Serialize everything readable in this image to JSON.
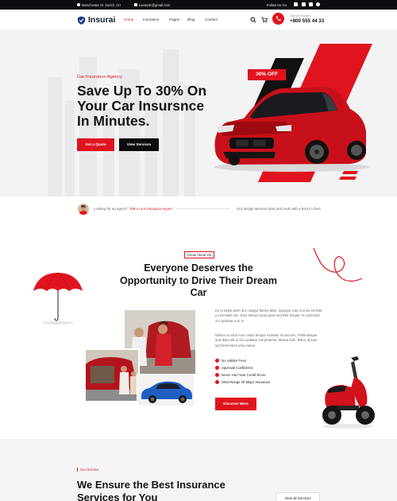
{
  "topbar": {
    "address": "Manchester St. Zurich, CH",
    "email": "example@gmail.com",
    "follow_label": "Follow Us On"
  },
  "header": {
    "logo": "Insurai",
    "nav": [
      "Home",
      "Insurance",
      "Pages",
      "Blog",
      "Contact"
    ],
    "call_label": "Call Us Expert",
    "call_number": "+800 555 44 33"
  },
  "hero": {
    "tag": "Car Insurance Agency",
    "title": "Save Up To 30% On Your Car Insursnce In Minutes.",
    "quote_button": "Get a Quote",
    "services_button": "View Services",
    "discount_badge": "30% OFF"
  },
  "strip": {
    "question": "Looking for an agent?",
    "link": "Talk to our insurance expert",
    "right_text": "Our design services start and ends with a best in class"
  },
  "about": {
    "badge": "Know About Us",
    "title": "Everyone Deserves the Opportunity to Drive Their Dream Car",
    "paragraph1": "Eu ut turpis amet id in magna fames diam. Quisque cras ut enim est felis a venenatis nec. Duis ultrices lacus proin sed felis feugiat. At commodo orci pulvinar a ac in.",
    "paragraph2": "Nullam eu nibh nunc etiam tempor molestie sit sed nec. Pellentesque quis diam elit ut dui curabitur nisi pharetra. Massa felis. Tellus, dictum sed fermentum urna varius.",
    "checklist": [
      "No Hidden Fees",
      "Approval Confidence",
      "Never Hurt Your Credit Score",
      "Wied Range Of Major Insurance"
    ],
    "button": "Discover More"
  },
  "services": {
    "tag": "Our Service",
    "title": "We Ensure the Best Insurance Services for You",
    "button": "View all Services"
  },
  "colors": {
    "accent": "#e0141e",
    "dark": "#0d0d12",
    "hero_bg": "#f3f3f4"
  }
}
